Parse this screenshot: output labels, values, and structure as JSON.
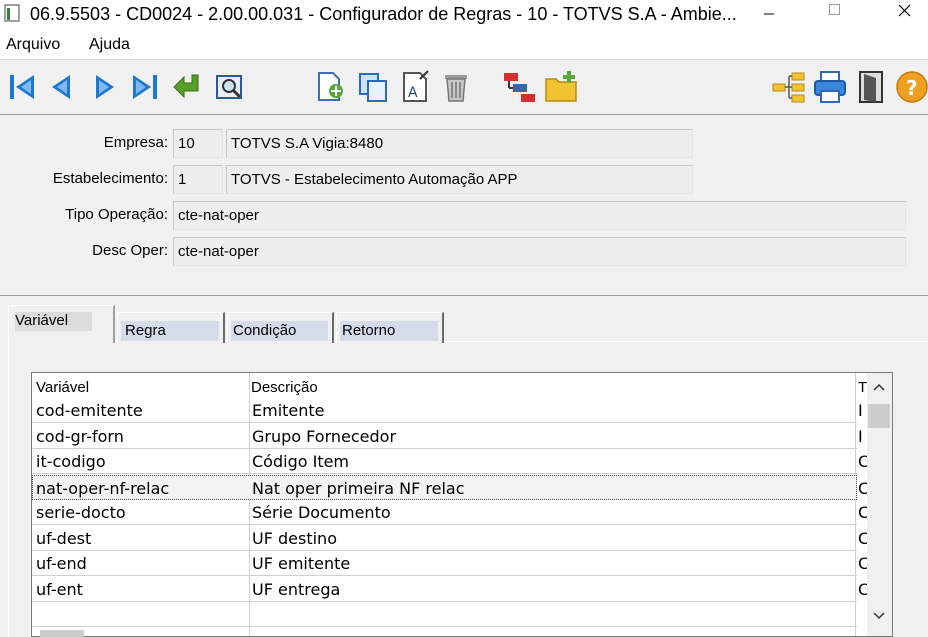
{
  "window": {
    "title": "06.9.5503 - CD0024 - 2.00.00.031 - Configurador de Regras - 10 - TOTVS S.A - Ambie..."
  },
  "menu": {
    "items": [
      "Arquivo",
      "Ajuda"
    ]
  },
  "toolbar": {
    "buttons": [
      {
        "icon": "first-record-icon"
      },
      {
        "icon": "previous-record-icon"
      },
      {
        "icon": "next-record-icon"
      },
      {
        "icon": "last-record-icon"
      },
      {
        "icon": "goto-icon"
      },
      {
        "icon": "search-icon"
      },
      {
        "icon": "new-icon"
      },
      {
        "icon": "copy-icon"
      },
      {
        "icon": "edit-icon"
      },
      {
        "icon": "delete-icon"
      },
      {
        "icon": "hierarchy-icon"
      },
      {
        "icon": "folder-add-icon"
      },
      {
        "icon": "tree-icon"
      },
      {
        "icon": "print-icon"
      },
      {
        "icon": "exit-icon"
      },
      {
        "icon": "help-icon"
      }
    ],
    "colors": {
      "nav": "#1e78d2",
      "goto": "#58a02a",
      "folder": "#f2c230",
      "help": "#f0a020"
    }
  },
  "form": {
    "empresa": {
      "label": "Empresa:",
      "code": "10",
      "name": "TOTVS S.A Vigia:8480"
    },
    "estabelecimento": {
      "label": "Estabelecimento:",
      "code": "1",
      "name": "TOTVS - Estabelecimento Automação APP"
    },
    "tipo_operacao": {
      "label": "Tipo Operação:",
      "value": "cte-nat-oper"
    },
    "desc_oper": {
      "label": "Desc Oper:",
      "value": "cte-nat-oper"
    }
  },
  "tabs": [
    {
      "label": "Variável",
      "active": true
    },
    {
      "label": "Regra",
      "active": false
    },
    {
      "label": "Condição",
      "active": false
    },
    {
      "label": "Retorno",
      "active": false
    }
  ],
  "grid": {
    "columns": [
      "Variável",
      "Descrição",
      "T"
    ],
    "rows": [
      {
        "variavel": "cod-emitente",
        "descricao": "Emitente",
        "tipo": "I"
      },
      {
        "variavel": "cod-gr-forn",
        "descricao": "Grupo Fornecedor",
        "tipo": "I"
      },
      {
        "variavel": "it-codigo",
        "descricao": "Código Item",
        "tipo": "C"
      },
      {
        "variavel": "nat-oper-nf-relac",
        "descricao": "Nat oper primeira NF relac",
        "tipo": "C"
      },
      {
        "variavel": "serie-docto",
        "descricao": "Série Documento",
        "tipo": "C"
      },
      {
        "variavel": "uf-dest",
        "descricao": "UF destino",
        "tipo": "C"
      },
      {
        "variavel": "uf-end",
        "descricao": "UF emitente",
        "tipo": "C"
      },
      {
        "variavel": "uf-ent",
        "descricao": "UF entrega",
        "tipo": "C"
      },
      {
        "variavel": "",
        "descricao": "",
        "tipo": ""
      }
    ],
    "selected_row": 3
  }
}
